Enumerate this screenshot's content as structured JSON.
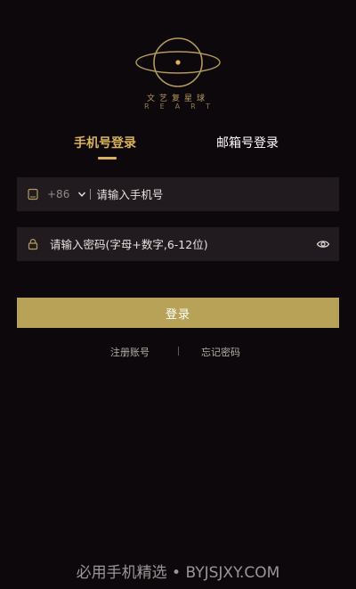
{
  "brand": {
    "name_cn": "文艺复星球",
    "name_en": "REART"
  },
  "tabs": [
    {
      "label": "手机号登录",
      "active": true
    },
    {
      "label": "邮箱号登录",
      "active": false
    }
  ],
  "phone_field": {
    "country_code": "+86",
    "placeholder": "请输入手机号",
    "value": ""
  },
  "password_field": {
    "placeholder": "请输入密码(字母+数字,6-12位)",
    "value": ""
  },
  "login_button": {
    "label": "登录"
  },
  "links": {
    "register": "注册账号",
    "forgot": "忘记密码"
  },
  "watermark": "必用手机精选 • BYJSJXY.COM",
  "colors": {
    "background": "#0d080c",
    "accent": "#d8b25c",
    "button": "#b7a257",
    "field_bg": "#211b20"
  },
  "icons": [
    "planet-logo-icon",
    "phone-icon",
    "chevron-down-icon",
    "lock-icon",
    "eye-icon"
  ]
}
